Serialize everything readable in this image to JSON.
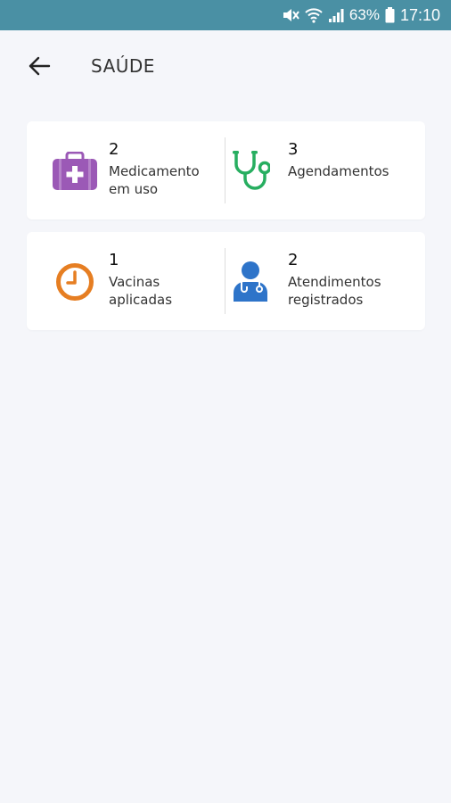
{
  "status_bar": {
    "battery_percent": "63%",
    "time": "17:10",
    "icons": [
      "mute-icon",
      "wifi-icon",
      "signal-icon",
      "battery-icon"
    ]
  },
  "header": {
    "back_icon": "arrow-left-icon",
    "title": "SAÚDE"
  },
  "cards": [
    {
      "items": [
        {
          "count": "2",
          "label_line1": "Medicamento",
          "label_line2": "em uso",
          "icon": "medical-kit-icon",
          "color": "#9b59b6"
        },
        {
          "count": "3",
          "label_line1": "Agendamentos",
          "label_line2": "",
          "icon": "stethoscope-icon",
          "color": "#27ae60"
        }
      ]
    },
    {
      "items": [
        {
          "count": "1",
          "label_line1": "Vacinas",
          "label_line2": "aplicadas",
          "icon": "clock-icon",
          "color": "#e67e22"
        },
        {
          "count": "2",
          "label_line1": "Atendimentos",
          "label_line2": "registrados",
          "icon": "doctor-icon",
          "color": "#2e74c9"
        }
      ]
    }
  ],
  "colors": {
    "status_bar": "#4a90a4",
    "background": "#f5f6fa",
    "card": "#ffffff"
  }
}
